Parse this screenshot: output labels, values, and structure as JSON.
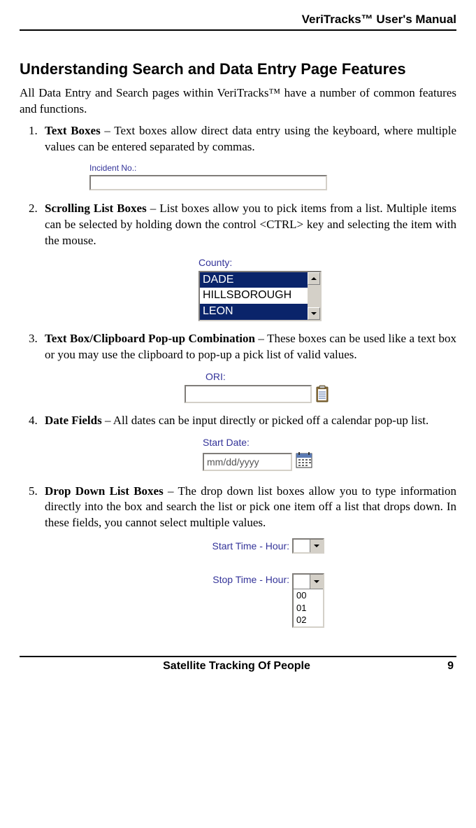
{
  "header": {
    "title": "VeriTracks™ User's Manual"
  },
  "section": {
    "heading": "Understanding Search and Data Entry Page Features",
    "intro": "All Data Entry and Search pages within VeriTracks™ have a number of common features and functions."
  },
  "items": [
    {
      "term": "Text Boxes",
      "desc": " – Text boxes allow direct data entry using the keyboard, where multiple values can be entered separated by commas."
    },
    {
      "term": "Scrolling List Boxes",
      "desc": " – List boxes allow you to pick items from a list. Multiple items can be selected by holding down the control <CTRL> key and selecting the item with the mouse."
    },
    {
      "term": "Text Box/Clipboard Pop-up Combination",
      "desc": " – These boxes can be used like a text box or you may use the clipboard to pop-up a pick list of valid values."
    },
    {
      "term": "Date Fields",
      "desc": " – All dates can be input directly or picked off a calendar pop-up list."
    },
    {
      "term": "Drop Down List Boxes",
      "desc": " – The drop down list boxes allow you to type information directly into the box and search the list or pick one item off a list that drops down.  In these fields, you cannot select multiple values."
    }
  ],
  "figures": {
    "incident": {
      "label": "Incident No.:",
      "value": ""
    },
    "county": {
      "label": "County:",
      "options": [
        "DADE",
        "HILLSBOROUGH",
        "LEON"
      ],
      "selected": [
        "DADE",
        "LEON"
      ]
    },
    "ori": {
      "label": "ORI:",
      "value": ""
    },
    "startDate": {
      "label": "Start Date:",
      "placeholder": "mm/dd/yyyy"
    },
    "time": {
      "startLabel": "Start Time - Hour:",
      "stopLabel": "Stop Time - Hour:",
      "startValue": "",
      "stopOptions": [
        "00",
        "01",
        "02"
      ]
    }
  },
  "footer": {
    "text": "Satellite Tracking Of People",
    "page": "9"
  }
}
